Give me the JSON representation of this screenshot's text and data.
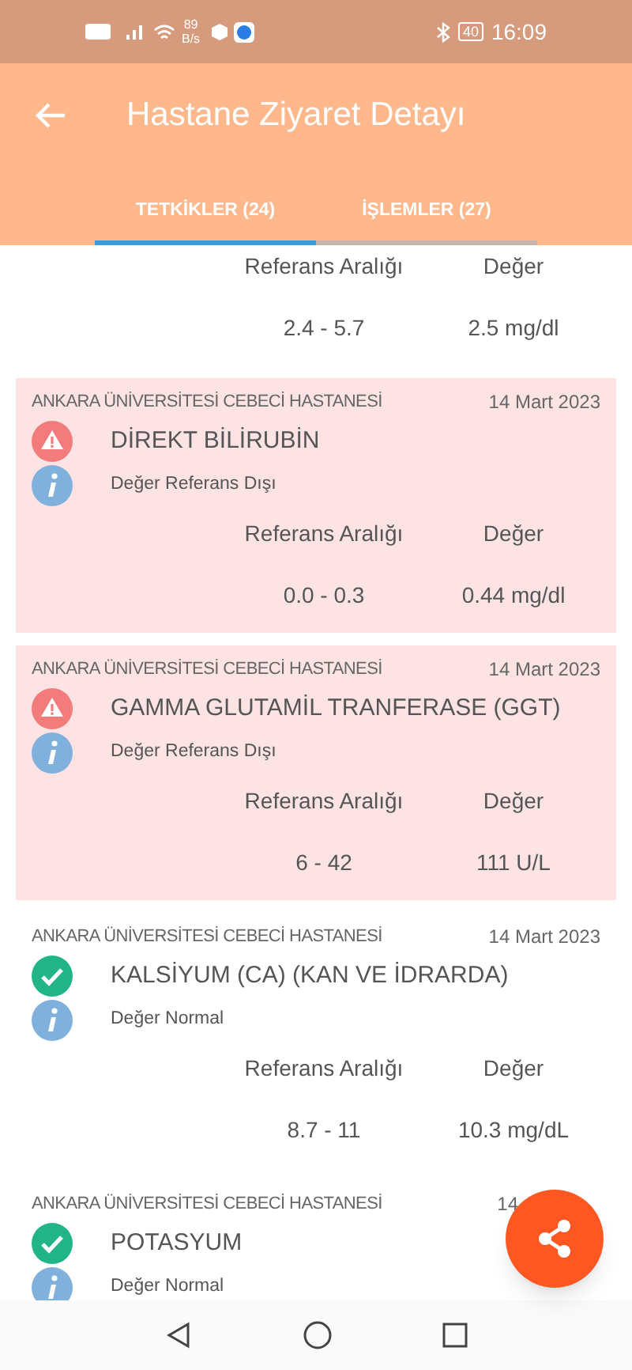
{
  "status_bar": {
    "speed_value": "89",
    "speed_unit": "B/s",
    "battery": "40",
    "time": "16:09"
  },
  "header": {
    "title": "Hastane Ziyaret Detayı"
  },
  "tabs": [
    {
      "label": "TETKİKLER (24)",
      "selected": true
    },
    {
      "label": "İŞLEMLER (27)",
      "selected": false
    }
  ],
  "results": [
    {
      "kind": "partial",
      "range_label": "Referans Aralığı",
      "value_label": "Değer",
      "range": "2.4 - 5.7",
      "value": "2.5 mg/dl"
    },
    {
      "kind": "warning",
      "hospital": "ANKARA ÜNİVERSİTESİ CEBECİ HASTANESİ",
      "date": "14 Mart 2023",
      "name": "DİREKT BİLİRUBİN",
      "note": "Değer Referans Dışı",
      "range_label": "Referans Aralığı",
      "value_label": "Değer",
      "range": "0.0 - 0.3",
      "value": "0.44 mg/dl"
    },
    {
      "kind": "warning",
      "hospital": "ANKARA ÜNİVERSİTESİ CEBECİ HASTANESİ",
      "date": "14 Mart 2023",
      "name": "GAMMA GLUTAMİL TRANFERASE (GGT)",
      "note": "Değer Referans Dışı",
      "range_label": "Referans Aralığı",
      "value_label": "Değer",
      "range": "6 - 42",
      "value": "111 U/L"
    },
    {
      "kind": "check",
      "hospital": "ANKARA ÜNİVERSİTESİ CEBECİ HASTANESİ",
      "date": "14 Mart 2023",
      "name": "KALSİYUM (CA) (KAN VE İDRARDA)",
      "note": "Değer Normal",
      "range_label": "Referans Aralığı",
      "value_label": "Değer",
      "range": "8.7 - 11",
      "value": "10.3 mg/dL"
    },
    {
      "kind": "check",
      "hospital": "ANKARA ÜNİVERSİTESİ CEBECİ HASTANESİ",
      "date": "14",
      "name": "POTASYUM",
      "note": "Değer Normal"
    }
  ]
}
